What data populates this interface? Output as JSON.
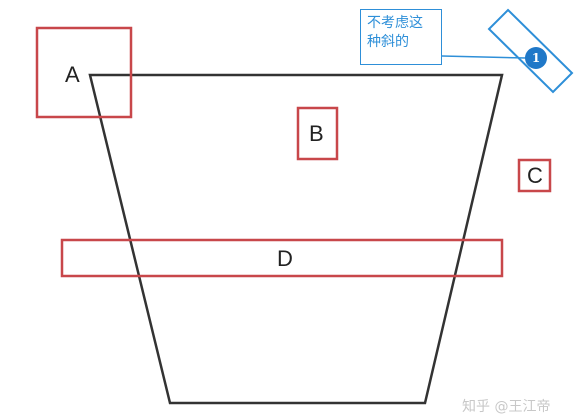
{
  "labels": {
    "a": "A",
    "b": "B",
    "c": "C",
    "d": "D"
  },
  "callout": {
    "line1": "不考虑这",
    "line2": "种斜的",
    "badge": "1"
  },
  "watermark": "知乎 @王江帝",
  "colors": {
    "shape_outline": "#333333",
    "box_outline": "#c8474a",
    "callout_accent": "#2e8fd8",
    "badge_fill": "#1f78c8"
  }
}
